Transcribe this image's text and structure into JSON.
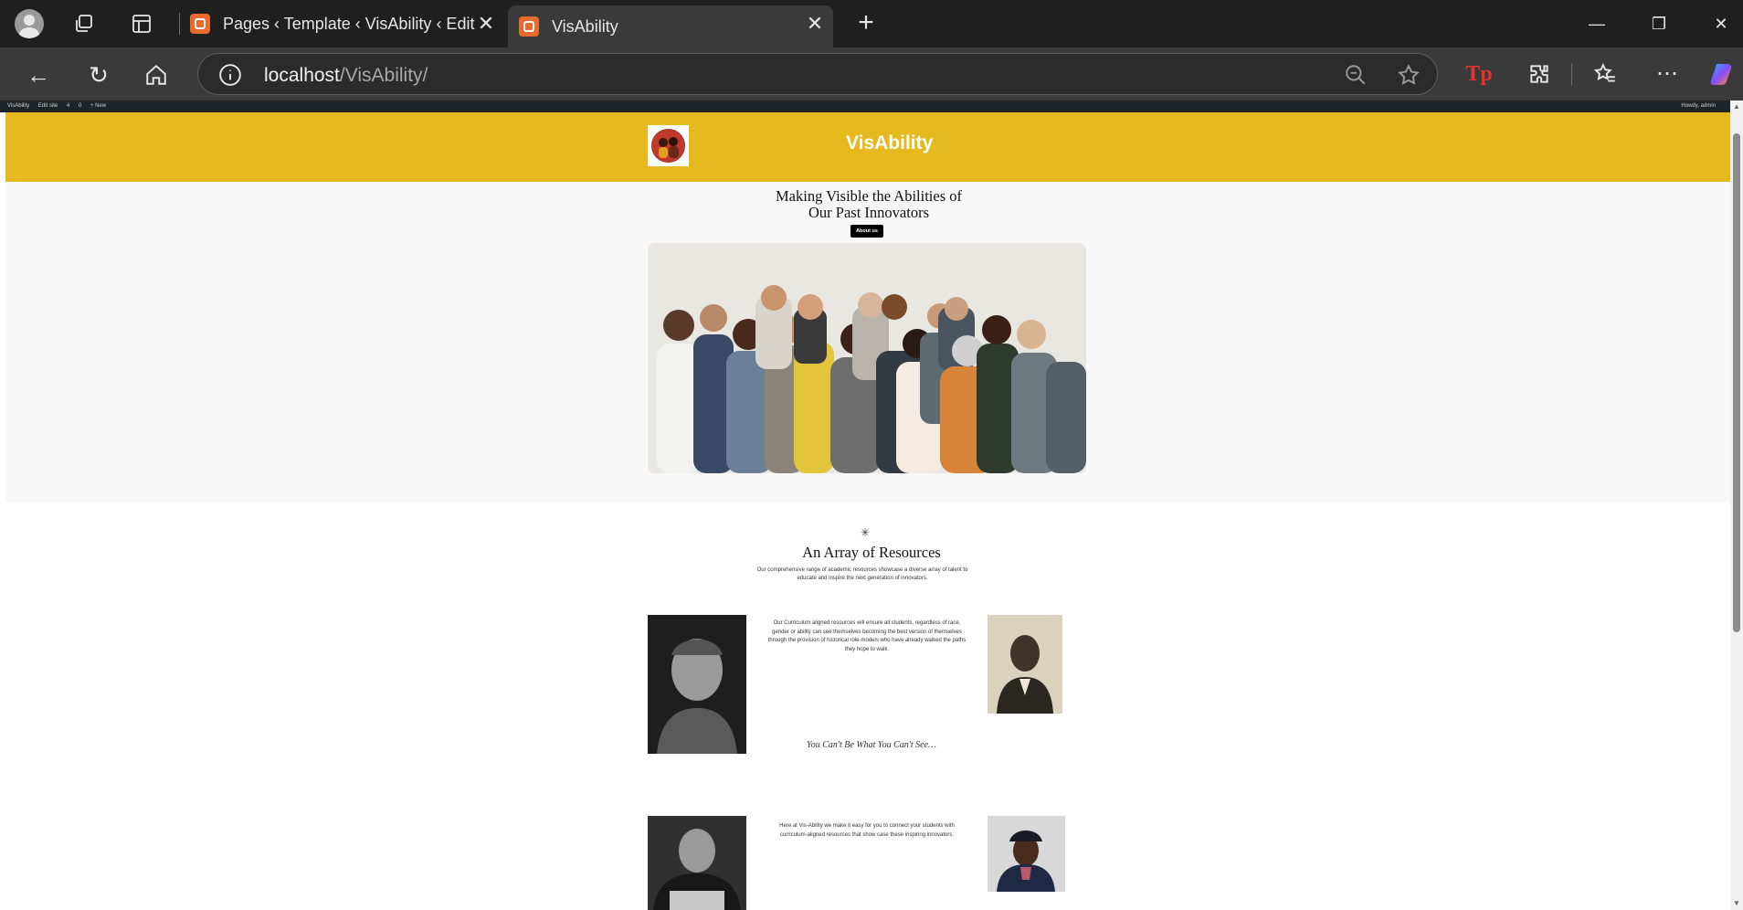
{
  "browser": {
    "tabs": [
      {
        "title": "Pages ‹ Template ‹ VisAbility ‹ Edit"
      },
      {
        "title": "VisAbility"
      }
    ],
    "url": {
      "host": "localhost",
      "path": "/VisAbility/"
    },
    "new_tab_label": "+"
  },
  "admin_bar": {
    "items": [
      "VisAbility",
      "Edit site",
      "4",
      "0",
      "+ New"
    ],
    "howdy": "Howdy, admin"
  },
  "site": {
    "title": "VisAbility",
    "header_color": "#e6b91e"
  },
  "hero": {
    "heading_line1": "Making Visible the Abilities of",
    "heading_line2": "Our Past Innovators",
    "button_label": "About us"
  },
  "resources": {
    "star": "✳",
    "heading": "An Array of Resources",
    "intro": "Our comprehensive range of academic resources showcase a diverse array of talent to educate and inspire the next generation of innovators.",
    "block1": "Our Curriculum aligned resources will ensure all students, regardless of race, gender or ability can see themselves becoming the best version of themselves through the provision of historical role-models who have already walked the paths they hope to walk.",
    "quote": "You Can't Be What You Can't See…",
    "block2": "Here at Vis-Ability we make it easy for you to connect your students with curriculum-aligned resources that show case these inspiring innovators."
  }
}
